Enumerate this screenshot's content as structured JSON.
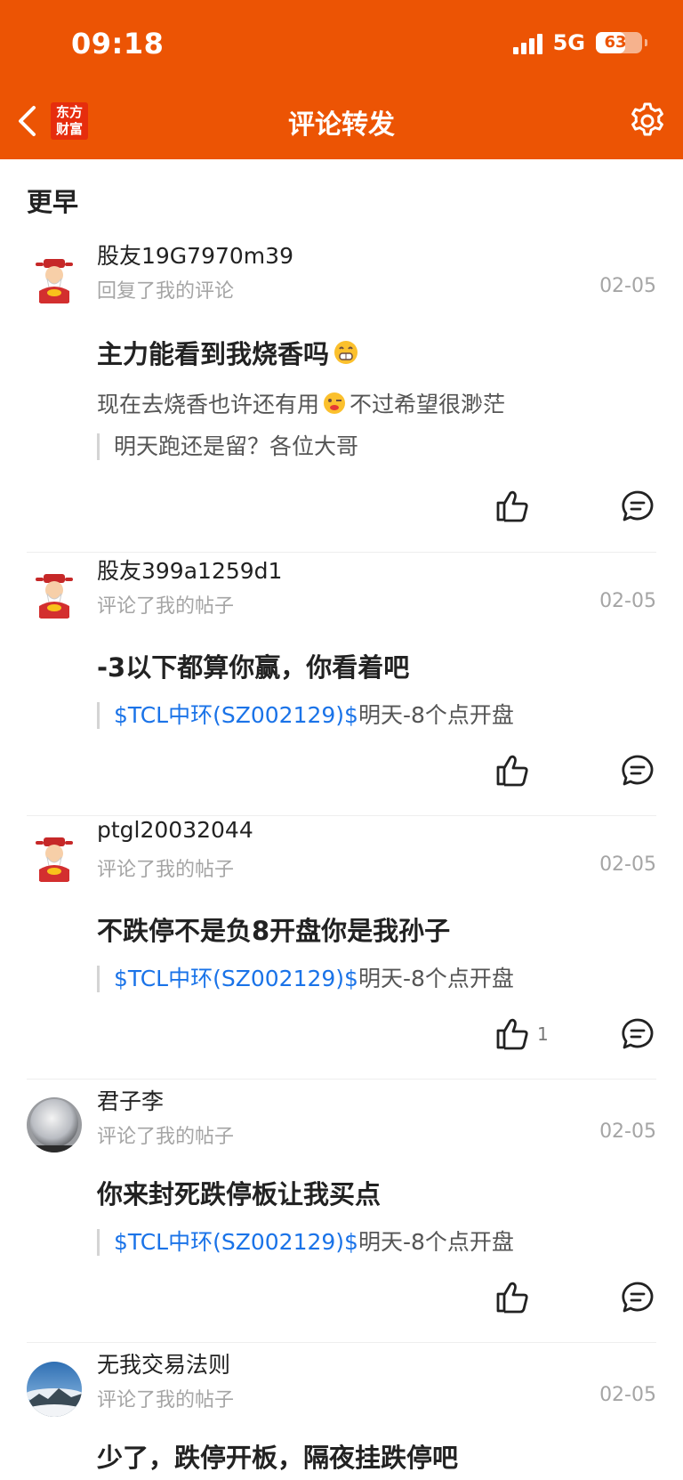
{
  "status_bar": {
    "time": "09:18",
    "network": "5G",
    "battery": "63",
    "battery_level": 0.63
  },
  "header": {
    "logo_text": "东方\n财富",
    "title": "评论转发"
  },
  "section": {
    "title": "更早"
  },
  "colors": {
    "header_bg": "#ec5404",
    "link": "#1a73e8"
  },
  "items": [
    {
      "username": "股友19G7970m39",
      "action": "回复了我的评论",
      "date": "02-05",
      "content": "主力能看到我烧香吗",
      "content_emoji": "grinning-face-icon",
      "subtext_before": "现在去烧香也许还有用",
      "subtext_emoji": "wink-face-icon",
      "subtext_after": "不过希望很渺茫",
      "quote_text": "明天跑还是留？各位大哥",
      "like_count": "",
      "avatar": "fortune-god-avatar"
    },
    {
      "username": "股友399a1259d1",
      "action": "评论了我的帖子",
      "date": "02-05",
      "content": "-3以下都算你赢，你看着吧",
      "quote_tag": "$TCL中环(SZ002129)$",
      "quote_text": "明天-8个点开盘",
      "like_count": "",
      "avatar": "fortune-god-avatar"
    },
    {
      "username": "ptgl20032044",
      "action": "评论了我的帖子",
      "date": "02-05",
      "content": "不跌停不是负8开盘你是我孙子",
      "quote_tag": "$TCL中环(SZ002129)$",
      "quote_text": "明天-8个点开盘",
      "like_count": "1",
      "avatar": "fortune-god-avatar"
    },
    {
      "username": "君子李",
      "action": "评论了我的帖子",
      "date": "02-05",
      "content": "你来封死跌停板让我买点",
      "quote_tag": "$TCL中环(SZ002129)$",
      "quote_text": "明天-8个点开盘",
      "like_count": "",
      "avatar": "gray-sphere-avatar"
    },
    {
      "username": "无我交易法则",
      "action": "评论了我的帖子",
      "date": "02-05",
      "content": "少了，跌停开板，隔夜挂跌停吧",
      "avatar": "mountain-sky-avatar"
    }
  ]
}
